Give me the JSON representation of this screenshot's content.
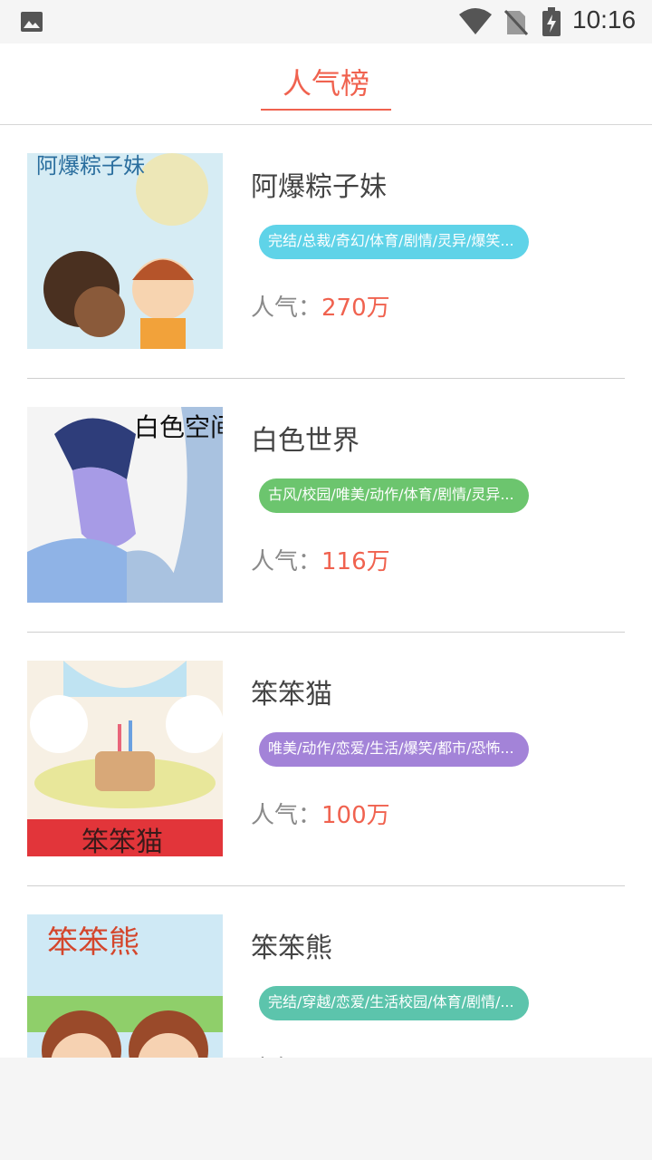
{
  "status_bar": {
    "time": "10:16",
    "icons": [
      "image-icon",
      "wifi-icon",
      "no-sim-icon",
      "battery-charging-icon"
    ]
  },
  "header": {
    "tab_title": "人气榜",
    "accent_color": "#f0624f"
  },
  "popularity_label": "人气：",
  "items": [
    {
      "title": "阿爆粽子妹",
      "tags": "完结/总裁/奇幻/体育/剧情/灵异/爆笑...",
      "tag_color": "#5fd3e8",
      "popularity": "270万",
      "cover_text": "阿爆粽子妹"
    },
    {
      "title": "白色世界",
      "tags": "古风/校园/唯美/动作/体育/剧情/灵异...",
      "tag_color": "#6cc56e",
      "popularity": "116万",
      "cover_text": "白色空间"
    },
    {
      "title": "笨笨猫",
      "tags": "唯美/动作/恋爱/生活/爆笑/都市/恐怖...",
      "tag_color": "#a383d8",
      "popularity": "100万",
      "cover_text": "笨笨猫"
    },
    {
      "title": "笨笨熊",
      "tags": "完结/穿越/恋爱/生活校园/体育/剧情/...",
      "tag_color": "#5cc4ac",
      "popularity": "",
      "cover_text": "笨笨熊"
    }
  ]
}
